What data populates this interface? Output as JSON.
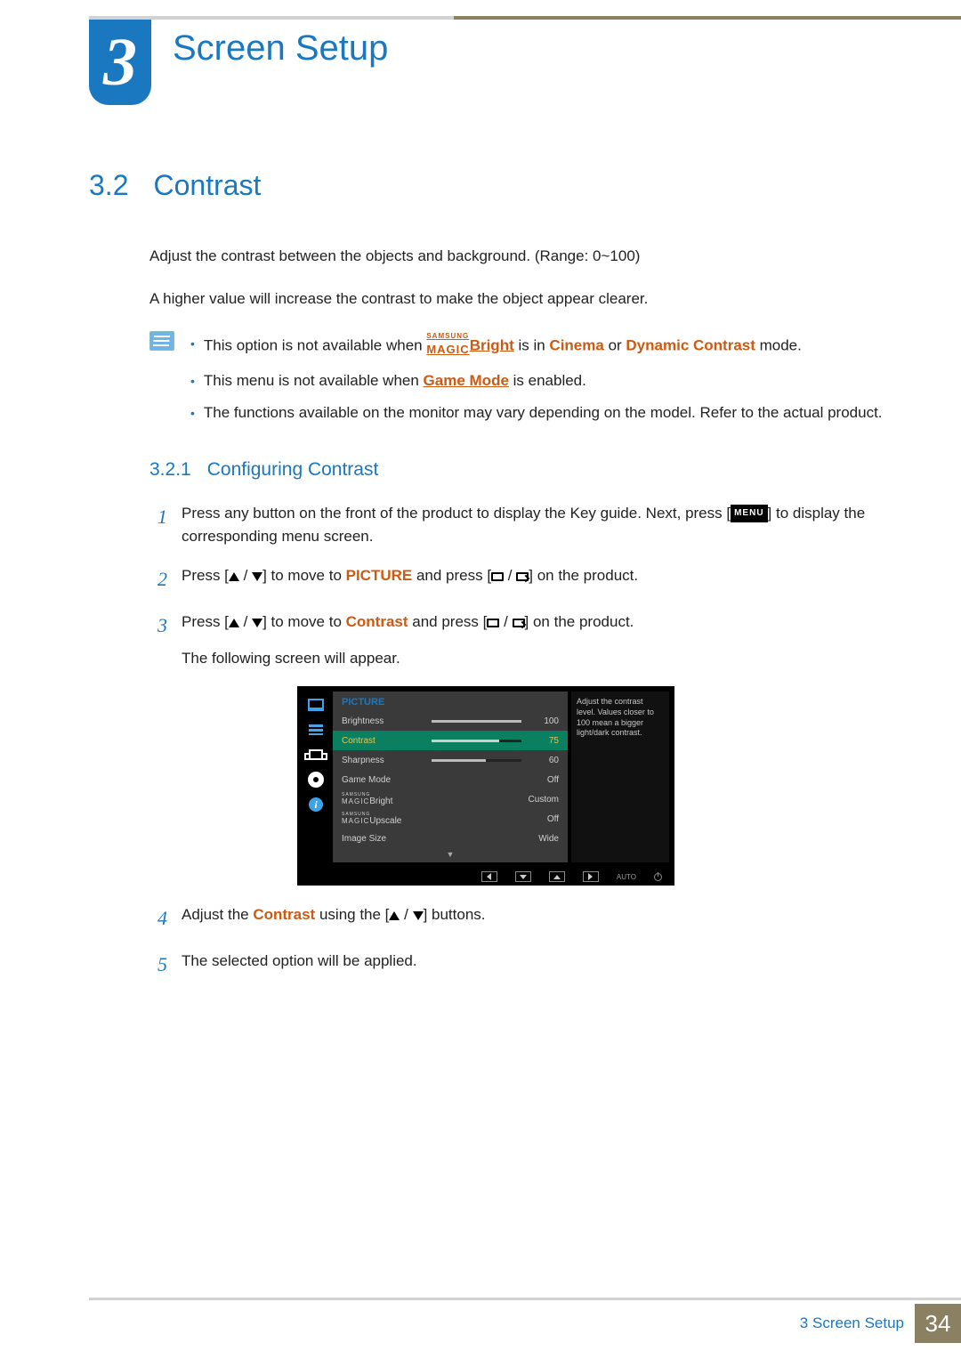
{
  "chapter": {
    "number": "3",
    "title": "Screen Setup"
  },
  "section": {
    "number": "3.2",
    "title": "Contrast"
  },
  "intro": {
    "p1": "Adjust the contrast between the objects and background. (Range: 0~100)",
    "p2": "A higher value will increase the contrast to make the object appear clearer."
  },
  "notes": {
    "n1_a": "This option is not available when ",
    "n1_b": " is in ",
    "n1_cinema": "Cinema",
    "n1_or": " or ",
    "n1_dynamic": "Dynamic Contrast",
    "n1_c": " mode.",
    "magic_small": "SAMSUNG",
    "magic_big": "MAGIC",
    "magic_bright": "Bright",
    "n2_a": "This menu is not available when ",
    "n2_game": "Game Mode",
    "n2_b": " is enabled.",
    "n3": "The functions available on the monitor may vary depending on the model. Refer to the actual product."
  },
  "subsection": {
    "number": "3.2.1",
    "title": "Configuring Contrast"
  },
  "steps": {
    "s1_a": "Press any button on the front of the product to display the Key guide. Next, press [",
    "s1_menu": "MENU",
    "s1_b": "] to display the corresponding menu screen.",
    "s2_a": "Press [",
    "s2_b": "] to move to ",
    "s2_picture": "PICTURE",
    "s2_c": " and press [",
    "s2_d": "] on the product.",
    "s3_a": "Press [",
    "s3_b": "] to move to ",
    "s3_contrast": "Contrast",
    "s3_c": " and press [",
    "s3_d": "] on the product.",
    "s3_e": "The following screen will appear.",
    "s4_a": "Adjust the ",
    "s4_contrast": "Contrast",
    "s4_b": " using the [",
    "s4_c": "] buttons.",
    "s5": "The selected option will be applied."
  },
  "osd": {
    "title": "PICTURE",
    "help": "Adjust the contrast level. Values closer to 100 mean a bigger light/dark contrast.",
    "rows": [
      {
        "label": "Brightness",
        "value": "100",
        "bar": 100
      },
      {
        "label": "Contrast",
        "value": "75",
        "bar": 75,
        "selected": true
      },
      {
        "label": "Sharpness",
        "value": "60",
        "bar": 60
      },
      {
        "label": "Game Mode",
        "value": "Off"
      },
      {
        "label": "Bright",
        "magic": true,
        "value": "Custom"
      },
      {
        "label": "Upscale",
        "magic": true,
        "value": "Off"
      },
      {
        "label": "Image Size",
        "value": "Wide"
      }
    ],
    "nav_auto": "AUTO"
  },
  "footer": {
    "text_prefix": "3",
    "text": "Screen Setup",
    "page": "34"
  }
}
